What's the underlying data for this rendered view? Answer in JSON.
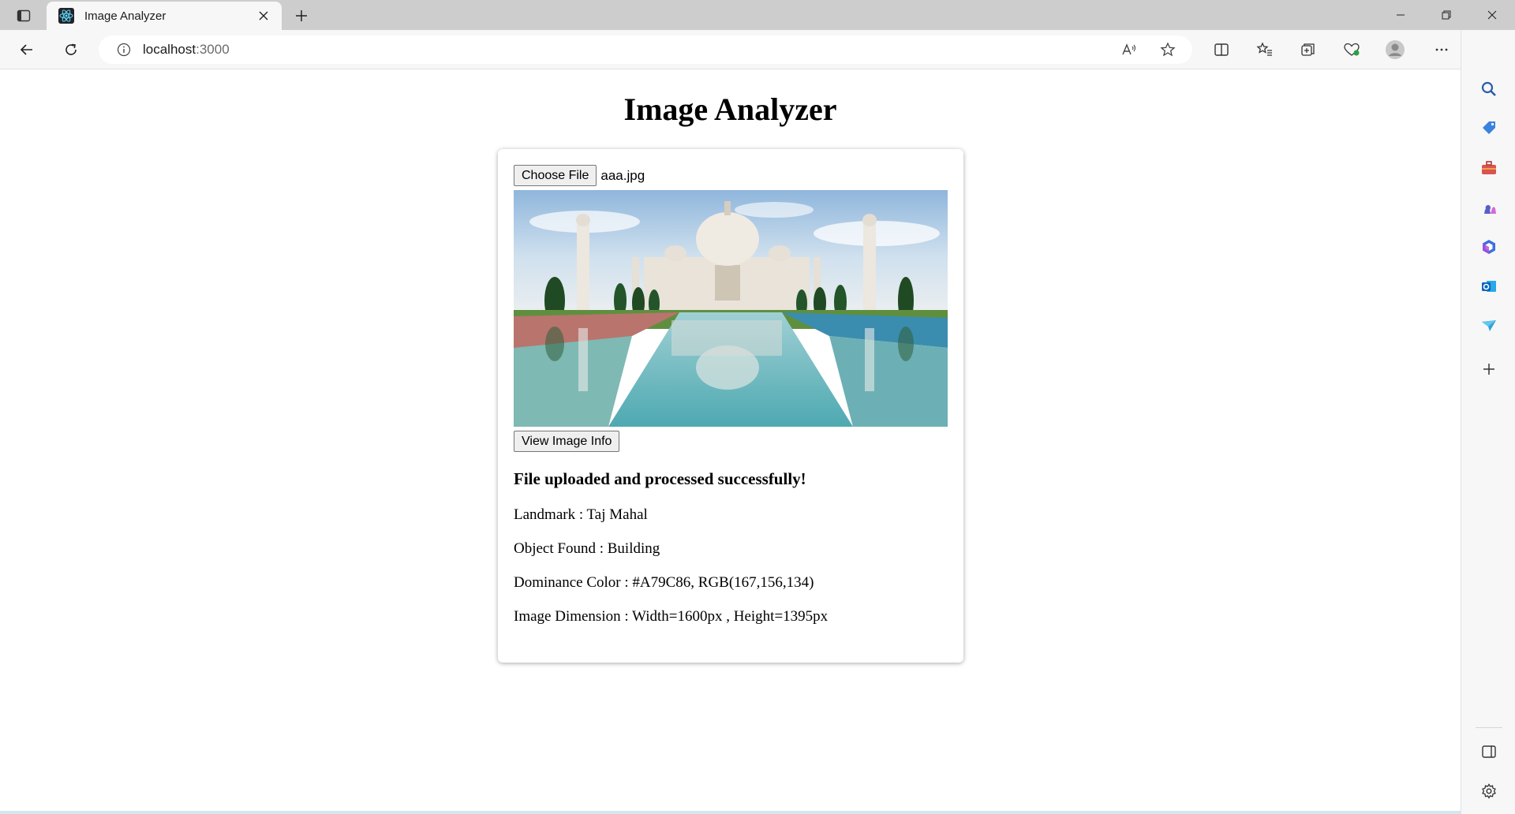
{
  "browser": {
    "tab": {
      "title": "Image Analyzer"
    },
    "address": {
      "host": "localhost",
      "port": ":3000"
    }
  },
  "page": {
    "title": "Image Analyzer",
    "choose_file_label": "Choose File",
    "file_name": "aaa.jpg",
    "image_alt": "Taj Mahal photo",
    "view_button_label": "View Image Info",
    "result_heading": "File uploaded and processed successfully!",
    "info": [
      "Landmark : Taj Mahal",
      "Object Found : Building",
      "Dominance Color : #A79C86, RGB(167,156,134)",
      "Image Dimension : Width=1600px , Height=1395px"
    ]
  },
  "colors": {
    "chrome_bg": "#cdcdcd",
    "toolbar_bg": "#f7f7f7",
    "accent_blue": "#1a73e8",
    "dominant_color": "#A79C86"
  },
  "icons": {
    "tab_actions": "tab-actions-icon",
    "favicon": "react-atom-icon",
    "sidebar": [
      "search-icon",
      "shopping-tag-icon",
      "toolbox-icon",
      "chess-icon",
      "office-icon",
      "outlook-icon",
      "send-icon",
      "plus-icon",
      "split-panel-icon",
      "settings-icon"
    ]
  }
}
